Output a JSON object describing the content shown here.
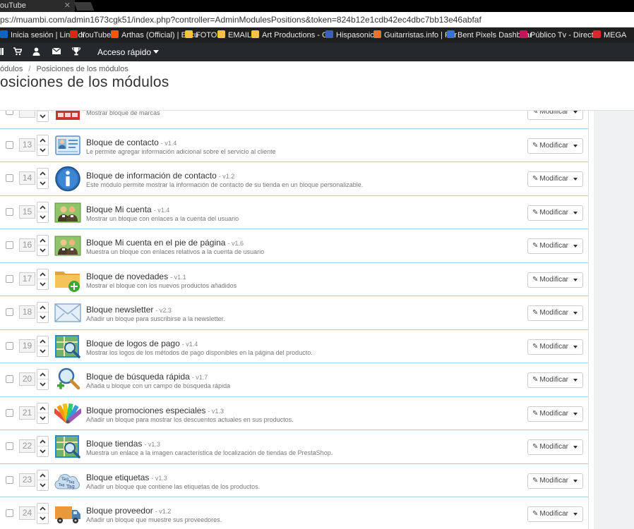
{
  "browser": {
    "tab_title": "ouTube",
    "tab_close": "✕",
    "url": "ps://muambi.com/admin1673cgk51/index.php?controller=AdminModulesPositions&token=824b12e1cdb42ec4dbc7bb13e46abfaf",
    "bookmarks": [
      {
        "label": "Inicia sesión | LinkedI",
        "color": "#0a66c2"
      },
      {
        "label": "YouTube",
        "color": "#e62117"
      },
      {
        "label": "Arthas (Official) | Escu",
        "color": "#ff5500"
      },
      {
        "label": "FOTO",
        "color": "#f5c242"
      },
      {
        "label": "EMAIL",
        "color": "#f5c242"
      },
      {
        "label": "Art Productions - GE",
        "color": "#f5c242"
      },
      {
        "label": "Hispasonic",
        "color": "#3b5fc0"
      },
      {
        "label": "Guitarristas.info | Por",
        "color": "#e8742a"
      },
      {
        "label": "Bent Pixels Dashboar",
        "color": "#3a6fd8"
      },
      {
        "label": "Público Tv - Directo",
        "color": "#c2185b"
      },
      {
        "label": "MEGA",
        "color": "#d9272e"
      }
    ]
  },
  "admin": {
    "quick_access": "Acceso rápido"
  },
  "header": {
    "breadcrumb_parent": "ódulos",
    "breadcrumb_sep": "/",
    "breadcrumb_current": "Posiciones de los módulos",
    "title": "osiciones de los módulos"
  },
  "colors": {
    "row_border": "#a8cfe3",
    "admin_bar": "#25282c"
  },
  "modules": [
    {
      "position": "",
      "name": "",
      "version": "",
      "description": "Mostrar bloque de marcas",
      "icon": "brands-icon"
    },
    {
      "position": "13",
      "name": "Bloque de contacto",
      "version": "- v1.4",
      "description": "Le permite agregar información adicional sobre el servicio al cliente",
      "icon": "contact-card-icon"
    },
    {
      "position": "14",
      "name": "Bloque de información de contacto",
      "version": "- v1.2",
      "description": "Este módulo permite mostrar la información de contacto de su tienda en un bloque personalizable.",
      "icon": "info-icon"
    },
    {
      "position": "15",
      "name": "Bloque Mi cuenta",
      "version": "- v1.4",
      "description": "Mostrar un bloque con enlaces a la cuenta del usuario",
      "icon": "users-icon"
    },
    {
      "position": "16",
      "name": "Bloque Mi cuenta en el pie de página",
      "version": "- v1.6",
      "description": "Muestra un bloque con enlaces relativos a la cuenta de usuario",
      "icon": "users-icon"
    },
    {
      "position": "17",
      "name": "Bloque de novedades",
      "version": "- v1.1",
      "description": "Mostrar el bloque con los nuevos productos añadidos",
      "icon": "folder-add-icon"
    },
    {
      "position": "18",
      "name": "Bloque newsletter",
      "version": "- v2.3",
      "description": "Añadir un bloque para suscribirse a la newsletter.",
      "icon": "envelope-icon"
    },
    {
      "position": "19",
      "name": "Bloque de logos de pago",
      "version": "- v1.4",
      "description": "Mostrar los logos de los métodos de pago disponibles en la página del producto.",
      "icon": "map-search-icon"
    },
    {
      "position": "20",
      "name": "Bloque de búsqueda rápida",
      "version": "- v1.7",
      "description": "Añada u bloque con un campo de búsqueda rápida",
      "icon": "search-add-icon"
    },
    {
      "position": "21",
      "name": "Bloque promociones especiales",
      "version": "- v1.3",
      "description": "Añadir un bloque para mostrar los descuentos actuales en sus productos.",
      "icon": "color-swatches-icon"
    },
    {
      "position": "22",
      "name": "Bloque tiendas",
      "version": "- v1.3",
      "description": "Muestra un enlace a la imagen característica de localización de tiendas de PrestaShop.",
      "icon": "map-search-icon"
    },
    {
      "position": "23",
      "name": "Bloque etiquetas",
      "version": "- v1.3",
      "description": "Añadir un bloque que contiene las etiquetas de los productos.",
      "icon": "tag-cloud-icon"
    },
    {
      "position": "24",
      "name": "Bloque proveedor",
      "version": "- v1.2",
      "description": "Añadir un bloque que muestre sus proveedores.",
      "icon": "truck-icon"
    }
  ],
  "row_action": {
    "label": "Modificar"
  }
}
